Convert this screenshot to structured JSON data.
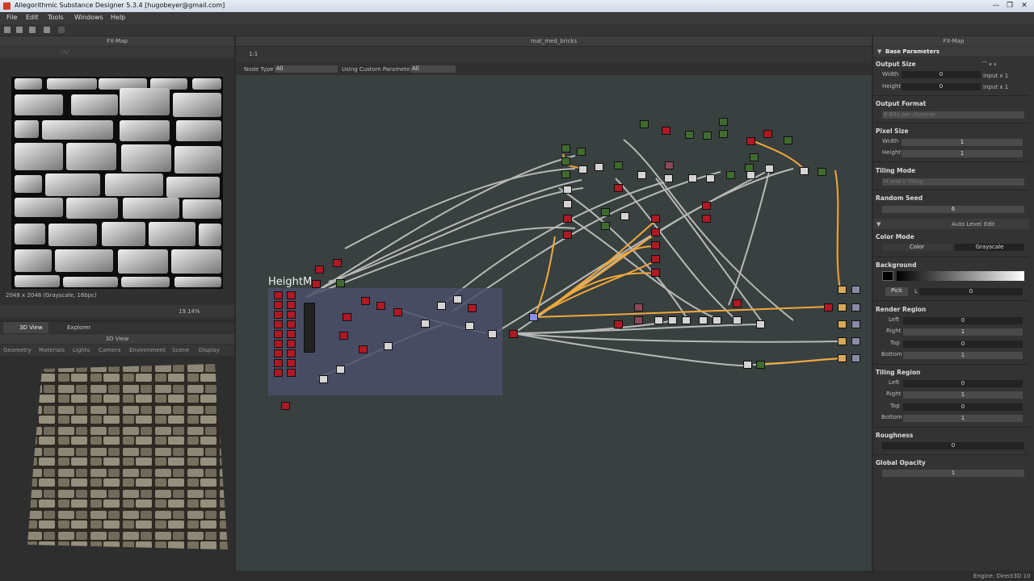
{
  "window": {
    "title": "Allegorithmic Substance Designer 5.3.4 [hugobeyer@gmail.com]",
    "btn_min": "—",
    "btn_max": "❐",
    "btn_close": "✕"
  },
  "menu": [
    "File",
    "Edit",
    "Tools",
    "Windows",
    "Help"
  ],
  "left_top": {
    "title": "FX-Map",
    "uv": "UV",
    "image_info": "2048 x 2048 (Grayscale, 16bpc)",
    "zoom": "19.14%"
  },
  "view3d": {
    "tab_active": "3D View",
    "tab_other": "Explorer",
    "header": "3D View",
    "menu": [
      "Geometry",
      "Materials",
      "Lights",
      "Camera",
      "Environment",
      "Scene",
      "Display"
    ]
  },
  "graph": {
    "title": "mat_med_bricks",
    "zoom_label": "1:1",
    "filter": {
      "node_type_label": "Node Type",
      "node_type_value": "All",
      "custom_label": "Using Custom Parameters",
      "custom_value": "All"
    },
    "frame_label": "HeightM"
  },
  "right": {
    "title": "FX-Map",
    "base_params": "Base Parameters",
    "output_size": {
      "label": "Output Size",
      "width_label": "Width",
      "width_value": "0",
      "width_suffix": "Input x 1",
      "height_label": "Height",
      "height_value": "0",
      "height_suffix": "Input x 1"
    },
    "output_format": {
      "label": "Output Format",
      "value": "8 Bits per channel"
    },
    "pixel_size": {
      "label": "Pixel Size",
      "width_label": "Width",
      "width_value": "1",
      "height_label": "Height",
      "height_value": "1"
    },
    "tiling_mode": {
      "label": "Tiling Mode",
      "value": "H and V Tiling"
    },
    "random_seed": {
      "label": "Random Seed",
      "value": "6"
    },
    "auto_level": {
      "label": "Auto Level",
      "edit": "Edit"
    },
    "color_mode": {
      "label": "Color Mode",
      "color": "Color",
      "grayscale": "Grayscale"
    },
    "background": {
      "label": "Background",
      "pick": "Pick",
      "l_label": "L",
      "value": "0"
    },
    "render_region": {
      "label": "Render Region",
      "left_label": "Left",
      "left_value": "0",
      "right_label": "Right",
      "right_value": "1",
      "top_label": "Top",
      "top_value": "0",
      "bottom_label": "Bottom",
      "bottom_value": "1"
    },
    "tiling_region": {
      "label": "Tiling Region",
      "left_label": "Left",
      "left_value": "0",
      "right_label": "Right",
      "right_value": "1",
      "top_label": "Top",
      "top_value": "0",
      "bottom_label": "Bottom",
      "bottom_value": "1"
    },
    "roughness": {
      "label": "Roughness",
      "value": "0"
    },
    "global_opacity": {
      "label": "Global Opacity",
      "value": "1"
    }
  },
  "status": {
    "engine": "Engine: Direct3D 10"
  }
}
